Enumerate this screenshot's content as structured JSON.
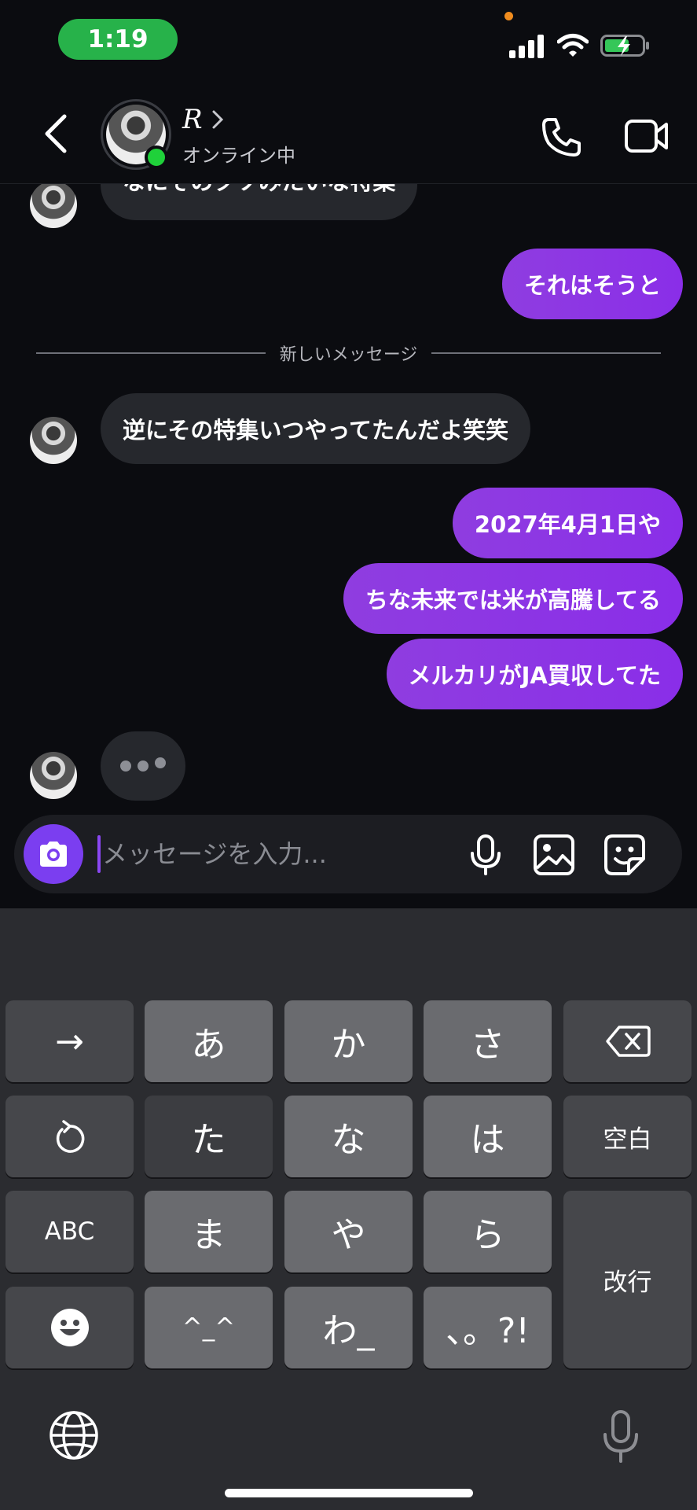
{
  "status_bar": {
    "time": "1:19"
  },
  "header": {
    "contact_name": "R",
    "presence": "オンライン中"
  },
  "messages": [
    {
      "direction": "incoming",
      "text": "なにそのクソみたいな特集"
    },
    {
      "direction": "outgoing",
      "text": "それはそうと"
    },
    {
      "direction": "divider",
      "text": "新しいメッセージ"
    },
    {
      "direction": "incoming",
      "text": "逆にその特集いつやってたんだよ笑笑"
    },
    {
      "direction": "outgoing",
      "text": "2027年4月1日や"
    },
    {
      "direction": "outgoing",
      "text": "ちな未来では米が高騰してる"
    },
    {
      "direction": "outgoing",
      "text": "メルカリがJA買収してた"
    }
  ],
  "composer": {
    "placeholder": "メッセージを入力..."
  },
  "keyboard": {
    "rows": [
      [
        "→",
        "あ",
        "か",
        "さ",
        "⌫"
      ],
      [
        "↺",
        "た",
        "な",
        "は",
        "空白"
      ],
      [
        "ABC",
        "ま",
        "や",
        "ら",
        "改行"
      ],
      [
        "☺",
        "^_^",
        "わ_",
        "、。?!"
      ]
    ],
    "arrow": "→",
    "a": "あ",
    "ka": "か",
    "sa": "さ",
    "ta": "た",
    "na": "な",
    "ha": "は",
    "space": "空白",
    "abc": "ABC",
    "ma": "ま",
    "ya": "や",
    "ra": "ら",
    "return": "改行",
    "kaomoji": "^_^",
    "wa": "わ_",
    "punct": "、。?!"
  },
  "colors": {
    "accent": "#8a2ee8",
    "online": "#1fd13a",
    "time_pill": "#27b24a"
  }
}
